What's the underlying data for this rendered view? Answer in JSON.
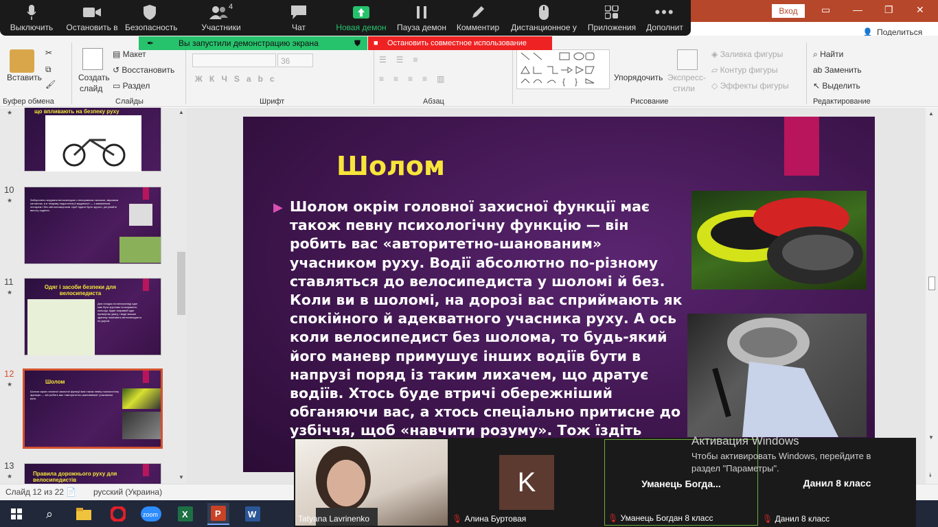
{
  "zoom": {
    "buttons": [
      {
        "label": "Выключить",
        "icon": "mic-icon",
        "badge": ""
      },
      {
        "label": "Остановить в",
        "icon": "video-icon",
        "badge": ""
      },
      {
        "label": "Безопасность",
        "icon": "shield-icon",
        "badge": ""
      },
      {
        "label": "Участники",
        "icon": "participants-icon",
        "badge": "4"
      },
      {
        "label": "Чат",
        "icon": "chat-icon",
        "badge": ""
      },
      {
        "label": "Новая демон",
        "icon": "share-screen-icon",
        "badge": ""
      },
      {
        "label": "Пауза демон",
        "icon": "pause-icon",
        "badge": ""
      },
      {
        "label": "Комментир",
        "icon": "annotate-icon",
        "badge": ""
      },
      {
        "label": "Дистанционное у",
        "icon": "remote-control-icon",
        "badge": ""
      },
      {
        "label": "Приложения",
        "icon": "apps-icon",
        "badge": ""
      },
      {
        "label": "Дополнит",
        "icon": "more-icon",
        "badge": ""
      }
    ],
    "sharing_banner": "Вы запустили демонстрацию экрана",
    "stop_share": "Остановить совместное использование"
  },
  "titlebar": {
    "signin": "Вход",
    "share": "Поделиться"
  },
  "ribbon": {
    "clipboard": {
      "paste": "Вставить",
      "group": "Буфер обмена"
    },
    "slides": {
      "new_slide": "Создать",
      "new_slide2": "слайд",
      "layout": "Макет",
      "reset": "Восстановить",
      "section": "Раздел",
      "group": "Слайды"
    },
    "font": {
      "size": "36",
      "group": "Шрифт"
    },
    "paragraph": {
      "group": "Абзац"
    },
    "drawing": {
      "arrange": "Упорядочить",
      "quick_styles": "Экспресс-",
      "quick_styles2": "стили",
      "fill": "Заливка фигуры",
      "outline": "Контур фигуры",
      "effects": "Эффекты фигуры",
      "group": "Рисование"
    },
    "editing": {
      "find": "Найти",
      "replace": "Заменить",
      "select": "Выделить",
      "group": "Редактирование"
    }
  },
  "thumbnails": [
    {
      "num": "",
      "title": "що впливають на безпеку руху",
      "body": ""
    },
    {
      "num": "10",
      "title": "",
      "body": "Заборонено керувати велосипедом з несправним гальмом, звуковим сигналом, а в темряву недостатньої видимості — з вимкненим ліхтарем і без світлоповертачів. Щоб їздити було зручно, регулюйте висоту сидіння."
    },
    {
      "num": "11",
      "title": "Одяг і засоби безпеки для велосипедиста",
      "body": "Для поїздок на велосипеді одяг має бути зручним та яскравого кольору. Адже яскравий одяг привертає увагу, і водії машин здалеку помічають велосипедиста на дорозі."
    },
    {
      "num": "12",
      "title": "Шолом",
      "body": "Шолом окрім головної захисної функції має також певну психологічну функцію — він робить вас «авторитетно-шанованим» учасником руху."
    },
    {
      "num": "13",
      "title": "Правила дорожнього руху для велосипедистів",
      "body": ""
    }
  ],
  "slide": {
    "title": "Шолом",
    "body": "Шолом окрім головної захисної функції має також певну психологічну функцію — він робить вас «авторитетно-шанованим» учасником руху. Водії абсолютно по-різному ставляться до велосипедиста у шоломі й без. Коли ви в шоломі, на дорозі вас сприймають як спокійного й адекватного учасника руху. А ось коли велосипедист без шолома, то будь-який його маневр примушує інших водіїв бути в напрузі поряд із таким лихачем, що дратує водіїв. Хтось буде втричі обережніший обганяючи вас, а хтось спеціально притисне до узбіччя, щоб «навчити розуму». Тож їздіть завжди в шоломі."
  },
  "status": {
    "slide": "Слайд 12 из 22",
    "language": "русский (Украина)"
  },
  "videos": [
    {
      "name": "Tatyana Lavrinenko",
      "center": "",
      "avatar": "",
      "muted": false
    },
    {
      "name": "Алина Буртовая",
      "center": "",
      "avatar": "K",
      "muted": true
    },
    {
      "name": "Уманець Богдан 8 класс",
      "center": "Уманець  Богда...",
      "avatar": "",
      "muted": true
    },
    {
      "name": "Данил 8 класс",
      "center": "Данил 8 класс",
      "avatar": "",
      "muted": true
    }
  ],
  "watermark": {
    "title": "Активация Windows",
    "line1": "Чтобы активировать Windows, перейдите в",
    "line2": "раздел \"Параметры\"."
  },
  "colors": {
    "zoom_bg": "#1a1a1a",
    "ppt_accent": "#b7472a",
    "slide_title": "#f7e53a",
    "slide_pink": "#b8155c",
    "green": "#27c26c"
  }
}
